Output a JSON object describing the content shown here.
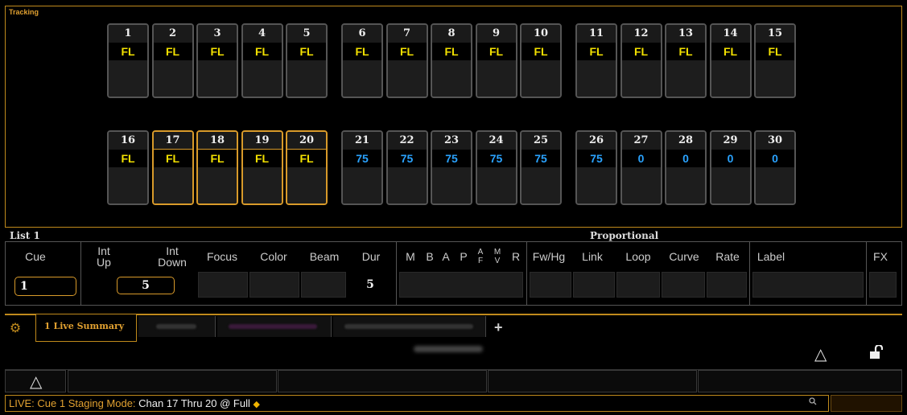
{
  "tracking": {
    "title": "Tracking",
    "channels_row1": [
      {
        "num": "1",
        "level": "FL"
      },
      {
        "num": "2",
        "level": "FL"
      },
      {
        "num": "3",
        "level": "FL"
      },
      {
        "num": "4",
        "level": "FL"
      },
      {
        "num": "5",
        "level": "FL"
      },
      {
        "num": "6",
        "level": "FL"
      },
      {
        "num": "7",
        "level": "FL"
      },
      {
        "num": "8",
        "level": "FL"
      },
      {
        "num": "9",
        "level": "FL"
      },
      {
        "num": "10",
        "level": "FL"
      },
      {
        "num": "11",
        "level": "FL"
      },
      {
        "num": "12",
        "level": "FL"
      },
      {
        "num": "13",
        "level": "FL"
      },
      {
        "num": "14",
        "level": "FL"
      },
      {
        "num": "15",
        "level": "FL"
      }
    ],
    "channels_row2": [
      {
        "num": "16",
        "level": "FL"
      },
      {
        "num": "17",
        "level": "FL"
      },
      {
        "num": "18",
        "level": "FL"
      },
      {
        "num": "19",
        "level": "FL"
      },
      {
        "num": "20",
        "level": "FL"
      },
      {
        "num": "21",
        "level": "75"
      },
      {
        "num": "22",
        "level": "75"
      },
      {
        "num": "23",
        "level": "75"
      },
      {
        "num": "24",
        "level": "75"
      },
      {
        "num": "25",
        "level": "75"
      },
      {
        "num": "26",
        "level": "75"
      },
      {
        "num": "27",
        "level": "0"
      },
      {
        "num": "28",
        "level": "0"
      },
      {
        "num": "29",
        "level": "0"
      },
      {
        "num": "30",
        "level": "0"
      }
    ]
  },
  "cue_list": {
    "title": "List 1",
    "proportional_label": "Proportional",
    "headers": {
      "cue": "Cue",
      "int_up": "Int\nUp",
      "int_down": "Int\nDown",
      "focus": "Focus",
      "color": "Color",
      "beam": "Beam",
      "dur": "Dur",
      "m": "M",
      "b": "B",
      "a": "A",
      "p": "P",
      "af_top": "A",
      "af_bot": "F",
      "mv_top": "M",
      "mv_bot": "V",
      "r": "R",
      "fwhg": "Fw/Hg",
      "link": "Link",
      "loop": "Loop",
      "curve": "Curve",
      "rate": "Rate",
      "label": "Label",
      "fx": "FX"
    },
    "row": {
      "cue": "1",
      "int_down": "5",
      "dur": "5"
    }
  },
  "tabs": {
    "active": "1 Live Summary",
    "add": "+"
  },
  "command_line": {
    "prefix": "LIVE: Cue  1  Staging Mode:",
    "command": "Chan 17 Thru 20 @ Full",
    "marker": "◆"
  },
  "icons": {
    "gear": "gear-icon",
    "triangle": "△",
    "lock": "🔓",
    "search": "search-icon"
  },
  "colors": {
    "accent": "#c08a1c",
    "full_level": "#f2e000",
    "partial_level": "#2aa3ff",
    "selected_border": "#d89a2a"
  }
}
